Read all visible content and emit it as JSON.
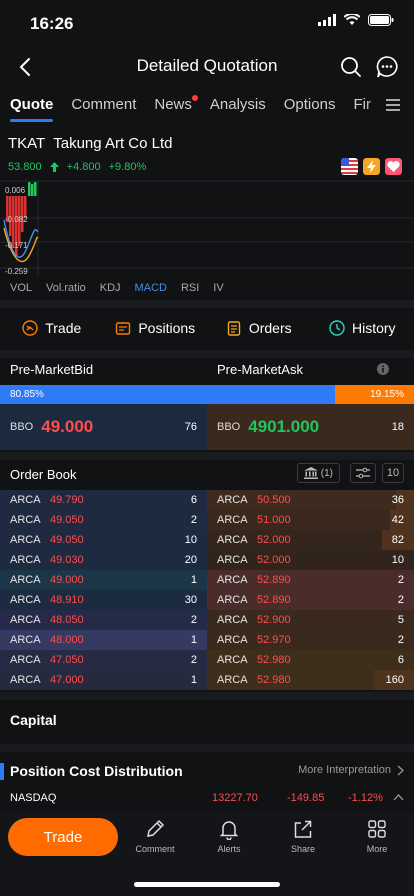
{
  "status": {
    "time": "16:26"
  },
  "nav": {
    "title": "Detailed Quotation"
  },
  "tabs": [
    {
      "label": "Quote",
      "active": true
    },
    {
      "label": "Comment"
    },
    {
      "label": "News",
      "dot": true
    },
    {
      "label": "Analysis"
    },
    {
      "label": "Options"
    },
    {
      "label": "Fir"
    }
  ],
  "stock": {
    "ticker": "TKAT",
    "name": "Takung Art Co Ltd",
    "price": "53.800",
    "change": "+4.800",
    "change_pct": "+9.80%",
    "up_color": "#22c55e"
  },
  "mini_chart": {
    "labels": [
      "0.006",
      "-0.082",
      "-0.171",
      "-0.259"
    ]
  },
  "chart_tabs": [
    "VOL",
    "Vol.ratio",
    "KDJ",
    "MACD",
    "RSI",
    "IV"
  ],
  "chart_tab_active": "MACD",
  "actions": [
    "Trade",
    "Positions",
    "Orders",
    "History"
  ],
  "bidask": {
    "bid_label": "Pre-MarketBid",
    "ask_label": "Pre-MarketAsk",
    "bid_pct": "80.85%",
    "ask_pct": "19.15%",
    "bid_ratio": 0.8085,
    "bid_color": "#2f7bf5",
    "ask_color": "#ff7a00",
    "bbo_label": "BBO",
    "bid_price": "49.000",
    "bid_size": "76",
    "ask_price": "4901.000",
    "ask_size": "18"
  },
  "order_book": {
    "title": "Order Book",
    "exchange_count": "(1)",
    "depth": "10",
    "bids": [
      {
        "ex": "ARCA",
        "price": "49.790",
        "size": "6"
      },
      {
        "ex": "ARCA",
        "price": "49.050",
        "size": "2"
      },
      {
        "ex": "ARCA",
        "price": "49.050",
        "size": "10"
      },
      {
        "ex": "ARCA",
        "price": "49.030",
        "size": "20"
      },
      {
        "ex": "ARCA",
        "price": "49.000",
        "size": "1"
      },
      {
        "ex": "ARCA",
        "price": "48.910",
        "size": "30"
      },
      {
        "ex": "ARCA",
        "price": "48.050",
        "size": "2"
      },
      {
        "ex": "ARCA",
        "price": "48.000",
        "size": "1"
      },
      {
        "ex": "ARCA",
        "price": "47.050",
        "size": "2"
      },
      {
        "ex": "ARCA",
        "price": "47.000",
        "size": "1"
      }
    ],
    "asks": [
      {
        "ex": "ARCA",
        "price": "50.500",
        "size": "36"
      },
      {
        "ex": "ARCA",
        "price": "51.000",
        "size": "42"
      },
      {
        "ex": "ARCA",
        "price": "52.000",
        "size": "82"
      },
      {
        "ex": "ARCA",
        "price": "52.000",
        "size": "10"
      },
      {
        "ex": "ARCA",
        "price": "52.890",
        "size": "2"
      },
      {
        "ex": "ARCA",
        "price": "52.890",
        "size": "2"
      },
      {
        "ex": "ARCA",
        "price": "52.900",
        "size": "5"
      },
      {
        "ex": "ARCA",
        "price": "52.970",
        "size": "2"
      },
      {
        "ex": "ARCA",
        "price": "52.980",
        "size": "6"
      },
      {
        "ex": "ARCA",
        "price": "52.980",
        "size": "160"
      }
    ]
  },
  "capital": {
    "title": "Capital"
  },
  "pcd": {
    "title": "Position Cost Distribution",
    "more": "More Interpretation"
  },
  "index_bar": {
    "name": "NASDAQ",
    "value": "13227.70",
    "change": "-149.85",
    "change_pct": "-1.12%"
  },
  "bottom": {
    "trade": "Trade",
    "items": [
      "Comment",
      "Alerts",
      "Share",
      "More"
    ]
  }
}
